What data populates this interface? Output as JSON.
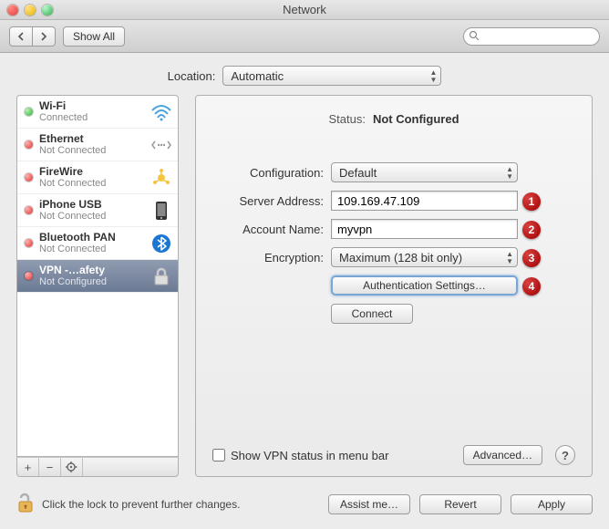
{
  "window": {
    "title": "Network"
  },
  "toolbar": {
    "show_all": "Show All",
    "search_placeholder": ""
  },
  "location": {
    "label": "Location:",
    "value": "Automatic"
  },
  "sidebar": {
    "items": [
      {
        "name": "Wi-Fi",
        "sub": "Connected",
        "status": "green",
        "icon": "wifi"
      },
      {
        "name": "Ethernet",
        "sub": "Not Connected",
        "status": "red",
        "icon": "ethernet"
      },
      {
        "name": "FireWire",
        "sub": "Not Connected",
        "status": "red",
        "icon": "firewire"
      },
      {
        "name": "iPhone USB",
        "sub": "Not Connected",
        "status": "red",
        "icon": "iphone"
      },
      {
        "name": "Bluetooth PAN",
        "sub": "Not Connected",
        "status": "red",
        "icon": "bluetooth"
      },
      {
        "name": "VPN -…afety",
        "sub": "Not Configured",
        "status": "red",
        "icon": "vpn",
        "selected": true
      }
    ]
  },
  "details": {
    "status_label": "Status:",
    "status_value": "Not Configured",
    "config_label": "Configuration:",
    "config_value": "Default",
    "server_label": "Server Address:",
    "server_value": "109.169.47.109",
    "account_label": "Account Name:",
    "account_value": "myvpn",
    "encryption_label": "Encryption:",
    "encryption_value": "Maximum (128 bit only)",
    "auth_button": "Authentication Settings…",
    "connect_button": "Connect",
    "show_status_label": "Show VPN status in menu bar",
    "advanced_button": "Advanced…"
  },
  "callouts": {
    "c1": "1",
    "c2": "2",
    "c3": "3",
    "c4": "4"
  },
  "bottom": {
    "lock_note": "Click the lock to prevent further changes.",
    "assist": "Assist me…",
    "revert": "Revert",
    "apply": "Apply"
  }
}
